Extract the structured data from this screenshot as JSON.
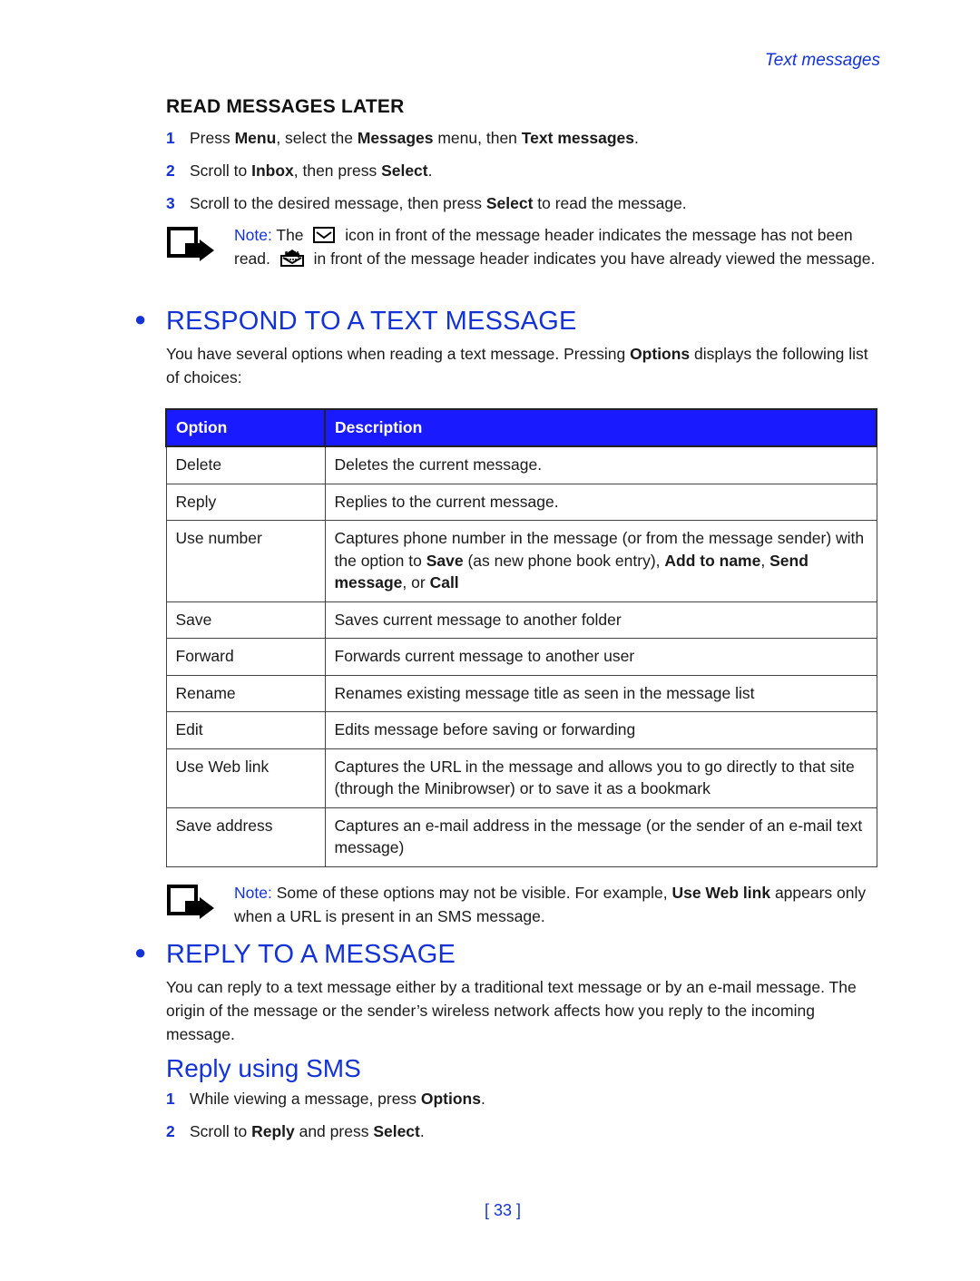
{
  "running_head": "Text messages",
  "read_later": {
    "heading": "READ MESSAGES LATER",
    "steps": [
      {
        "num": "1",
        "parts": [
          "Press ",
          "Menu",
          ", select the ",
          "Messages",
          " menu, then ",
          "Text messages",
          "."
        ]
      },
      {
        "num": "2",
        "parts": [
          "Scroll to ",
          "Inbox",
          ", then press ",
          "Select",
          "."
        ]
      },
      {
        "num": "3",
        "parts": [
          "Scroll to the desired message, then press ",
          "Select",
          " to read the message."
        ]
      }
    ],
    "note": {
      "label": "Note:",
      "text_a": " The ",
      "icon_unread": "envelope-unread-icon",
      "text_b": " icon in front of the message header indicates the message has not been read. ",
      "icon_read": "envelope-read-icon",
      "text_c": " in front of the message header indicates you have already viewed the message."
    }
  },
  "respond": {
    "heading": "RESPOND TO A TEXT MESSAGE",
    "intro_parts": [
      "You have several options when reading a text message. Pressing ",
      "Options",
      " displays the following list of choices:"
    ],
    "table": {
      "headers": [
        "Option",
        "Description"
      ],
      "rows": [
        {
          "option": "Delete",
          "desc": [
            [
              "Deletes the current message.",
              false
            ]
          ]
        },
        {
          "option": "Reply",
          "desc": [
            [
              "Replies to the current message.",
              false
            ]
          ]
        },
        {
          "option": "Use number",
          "desc": [
            [
              "Captures phone number in the message (or from the message sender) with the option to ",
              false
            ],
            [
              "Save",
              true
            ],
            [
              " (as new phone book entry), ",
              false
            ],
            [
              "Add to name",
              true
            ],
            [
              ", ",
              false
            ],
            [
              "Send message",
              true
            ],
            [
              ", or ",
              false
            ],
            [
              "Call",
              true
            ]
          ]
        },
        {
          "option": "Save",
          "desc": [
            [
              "Saves current message to another folder",
              false
            ]
          ]
        },
        {
          "option": "Forward",
          "desc": [
            [
              "Forwards current message to another user",
              false
            ]
          ]
        },
        {
          "option": "Rename",
          "desc": [
            [
              "Renames existing message title as seen in the message list",
              false
            ]
          ]
        },
        {
          "option": "Edit",
          "desc": [
            [
              "Edits message before saving or forwarding",
              false
            ]
          ]
        },
        {
          "option": "Use Web link",
          "desc": [
            [
              "Captures the URL in the message and allows you to go directly to that site (through the Minibrowser) or to save it as a bookmark",
              false
            ]
          ]
        },
        {
          "option": "Save address",
          "desc": [
            [
              "Captures an e-mail address in the message (or the sender of an e-mail text message)",
              false
            ]
          ]
        }
      ]
    },
    "note": {
      "label": "Note:",
      "parts": [
        " Some of these options may not be visible. For example, ",
        "Use Web link",
        " appears only when a URL is present in an SMS message."
      ]
    }
  },
  "reply": {
    "heading": "REPLY TO A MESSAGE",
    "intro": "You can reply to a text message either by a traditional text message or by an e-mail message. The origin of the message or the sender’s wireless network affects how you reply to the incoming message.",
    "sub_heading": "Reply using SMS",
    "steps": [
      {
        "num": "1",
        "parts": [
          "While viewing a message, press ",
          "Options",
          "."
        ]
      },
      {
        "num": "2",
        "parts": [
          "Scroll to ",
          "Reply",
          " and press ",
          "Select",
          "."
        ]
      }
    ]
  },
  "page_number": "[ 33 ]",
  "colors": {
    "accent": "#1433d6",
    "table_header": "#1a1aff"
  }
}
